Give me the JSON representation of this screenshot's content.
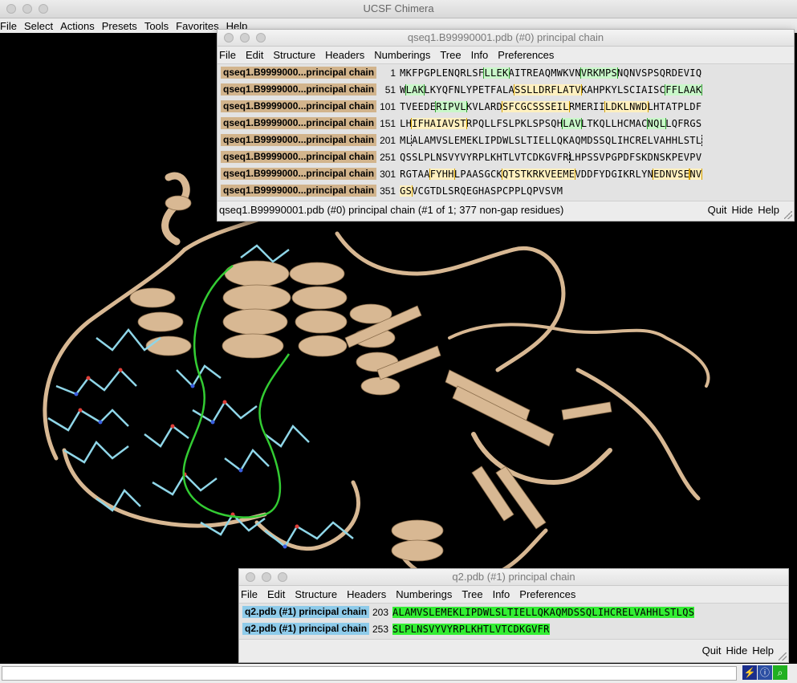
{
  "app": {
    "title": "UCSF Chimera",
    "menu": [
      "File",
      "Select",
      "Actions",
      "Presets",
      "Tools",
      "Favorites",
      "Help"
    ]
  },
  "seqwin1": {
    "title": "qseq1.B99990001.pdb (#0) principal chain",
    "menu": [
      "File",
      "Edit",
      "Structure",
      "Headers",
      "Numberings",
      "Tree",
      "Info",
      "Preferences"
    ],
    "name_color": "#d2b48c",
    "rows": [
      {
        "name": "qseq1.B9999000...principal chain",
        "num": "1",
        "segs": [
          [
            "MKFPGPLENQRLSF",
            ""
          ],
          [
            "LLEK",
            "g"
          ],
          [
            "AITREAQMWKVN",
            ""
          ],
          [
            "VRKMPS",
            "g"
          ],
          [
            "NQNVSPSQRDEVIQ",
            ""
          ]
        ]
      },
      {
        "name": "qseq1.B9999000...principal chain",
        "num": "51",
        "segs": [
          [
            "W",
            ""
          ],
          [
            "LAK",
            "g"
          ],
          [
            "LKYQFNLYPETFALA",
            ""
          ],
          [
            "SSLLDRFLATV",
            "y"
          ],
          [
            "KAHPKYLSCIAISC",
            ""
          ],
          [
            "FFLAAK",
            "g"
          ]
        ]
      },
      {
        "name": "qseq1.B9999000...principal chain",
        "num": "101",
        "segs": [
          [
            "TVEEDE",
            ""
          ],
          [
            "RIPVL",
            "g"
          ],
          [
            "KVLARD",
            ""
          ],
          [
            "SFCGCSSSEIL",
            "y"
          ],
          [
            "RMERII",
            ""
          ],
          [
            "LDKLNWD",
            "y"
          ],
          [
            "LHTATPLDF",
            ""
          ]
        ]
      },
      {
        "name": "qseq1.B9999000...principal chain",
        "num": "151",
        "segs": [
          [
            "LH",
            ""
          ],
          [
            "IFHAIAVST",
            "y"
          ],
          [
            "RPQLLFSLPKLSPSQH",
            ""
          ],
          [
            "LAV",
            "g"
          ],
          [
            "LTKQLLHCMAC",
            ""
          ],
          [
            "NQL",
            "g"
          ],
          [
            "LQFRGS",
            ""
          ]
        ]
      },
      {
        "name": "qseq1.B9999000...principal chain",
        "num": "201",
        "segs": [
          [
            "ML",
            ""
          ],
          [
            "ALAMVSLEMEKLIPDWLSLTIELLQKAQMDSSQLIHCRELVAHHLSTL",
            "d"
          ]
        ]
      },
      {
        "name": "qseq1.B9999000...principal chain",
        "num": "251",
        "segs": [
          [
            "QSSLPLNSVYVYRPLKHTLVTCDKGVFR",
            "d"
          ],
          [
            "LHPSSVPGPDFSKDNSKPEVPV",
            ""
          ]
        ]
      },
      {
        "name": "qseq1.B9999000...principal chain",
        "num": "301",
        "segs": [
          [
            "RGTAA",
            ""
          ],
          [
            "FYHH",
            "y"
          ],
          [
            "LPAASGCK",
            ""
          ],
          [
            "QTSTKRKVEEME",
            "y"
          ],
          [
            "VDDFYDGIKRLYN",
            ""
          ],
          [
            "EDNVSE",
            "y"
          ],
          [
            "NV",
            "y"
          ]
        ]
      },
      {
        "name": "qseq1.B9999000...principal chain",
        "num": "351",
        "segs": [
          [
            "GS",
            "y"
          ],
          [
            "VCGTDLSRQEGHASPCPPLQPVSVM",
            ""
          ]
        ]
      }
    ],
    "status": "qseq1.B99990001.pdb (#0) principal chain (#1 of 1; 377 non-gap residues)",
    "buttons": [
      "Quit",
      "Hide",
      "Help"
    ]
  },
  "seqwin2": {
    "title": "q2.pdb (#1) principal chain",
    "menu": [
      "File",
      "Edit",
      "Structure",
      "Headers",
      "Numberings",
      "Tree",
      "Info",
      "Preferences"
    ],
    "name_color": "#8ecbea",
    "seq_color": "#33ee33",
    "rows": [
      {
        "name": "q2.pdb (#1) principal chain",
        "num": "203",
        "seq": "ALAMVSLEMEKLIPDWLSLTIELLQKAQMDSSQLIHCRELVAHHLSTLQS"
      },
      {
        "name": "q2.pdb (#1) principal chain",
        "num": "253",
        "seq": "SLPLNSVYVYRPLKHTLVTCDKGVFR"
      }
    ],
    "buttons": [
      "Quit",
      "Hide",
      "Help"
    ]
  },
  "colors": {
    "ribbon": "#d8b893",
    "ligand_stick": "#8fd6e8",
    "highlight": "#33cc33"
  }
}
